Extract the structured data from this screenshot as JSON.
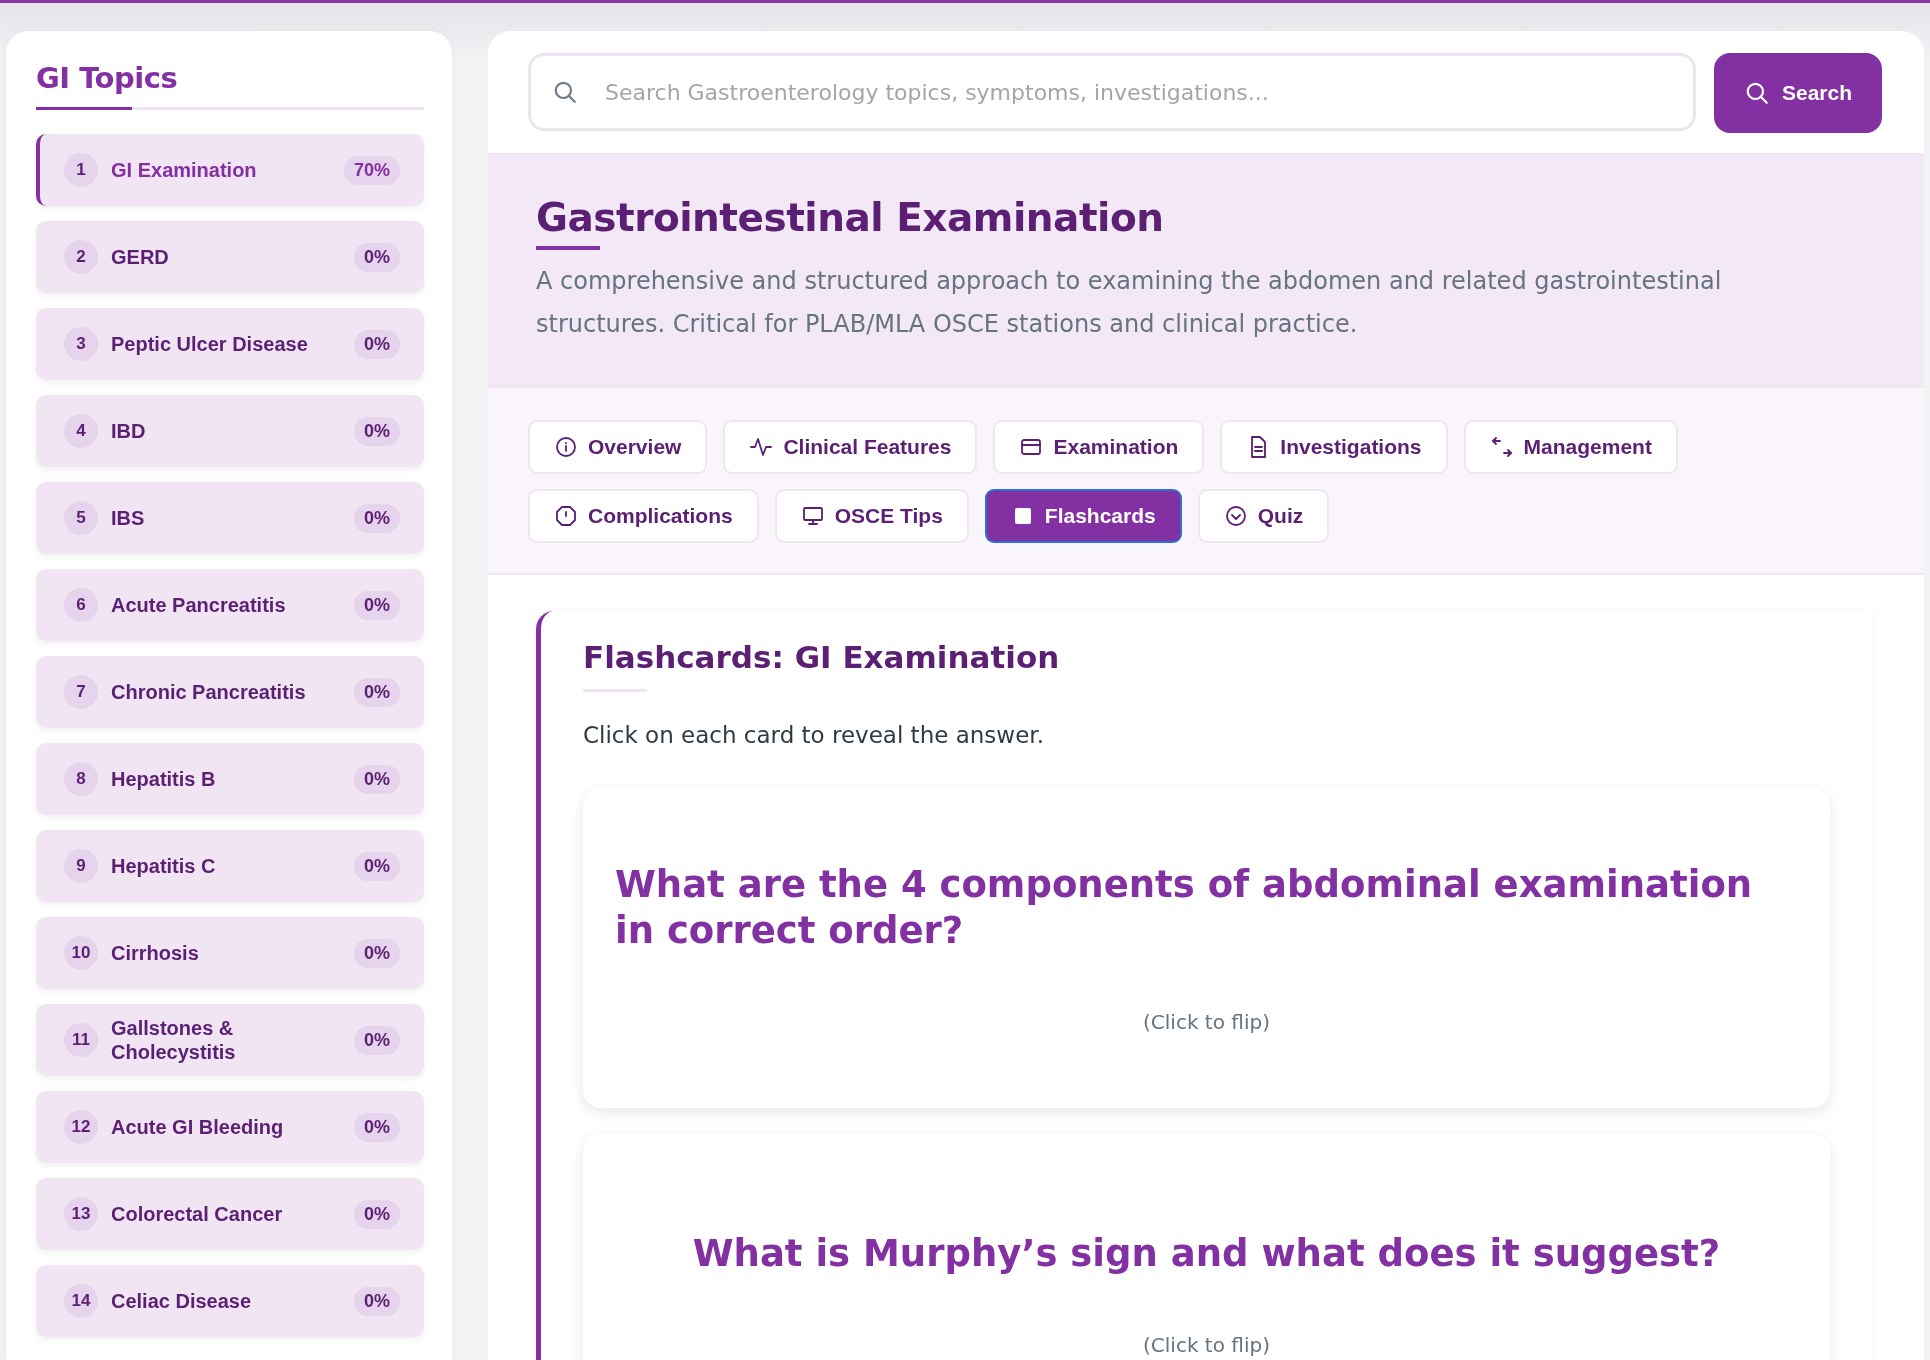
{
  "sidebar": {
    "title": "GI Topics",
    "items": [
      {
        "number": "1",
        "label": "GI Examination",
        "progress": "70%",
        "selected": true
      },
      {
        "number": "2",
        "label": "GERD",
        "progress": "0%",
        "selected": false
      },
      {
        "number": "3",
        "label": "Peptic Ulcer Disease",
        "progress": "0%",
        "selected": false
      },
      {
        "number": "4",
        "label": "IBD",
        "progress": "0%",
        "selected": false
      },
      {
        "number": "5",
        "label": "IBS",
        "progress": "0%",
        "selected": false
      },
      {
        "number": "6",
        "label": "Acute Pancreatitis",
        "progress": "0%",
        "selected": false
      },
      {
        "number": "7",
        "label": "Chronic Pancreatitis",
        "progress": "0%",
        "selected": false
      },
      {
        "number": "8",
        "label": "Hepatitis B",
        "progress": "0%",
        "selected": false
      },
      {
        "number": "9",
        "label": "Hepatitis C",
        "progress": "0%",
        "selected": false
      },
      {
        "number": "10",
        "label": "Cirrhosis",
        "progress": "0%",
        "selected": false
      },
      {
        "number": "11",
        "label": "Gallstones & Cholecystitis",
        "progress": "0%",
        "selected": false
      },
      {
        "number": "12",
        "label": "Acute GI Bleeding",
        "progress": "0%",
        "selected": false
      },
      {
        "number": "13",
        "label": "Colorectal Cancer",
        "progress": "0%",
        "selected": false
      },
      {
        "number": "14",
        "label": "Celiac Disease",
        "progress": "0%",
        "selected": false
      }
    ]
  },
  "search": {
    "placeholder": "Search Gastroenterology topics, symptoms, investigations...",
    "button": "Search"
  },
  "header": {
    "title": "Gastrointestinal Examination",
    "description": "A comprehensive and structured approach to examining the abdomen and related gastrointestinal structures. Critical for PLAB/MLA OSCE stations and clinical practice."
  },
  "tabs": [
    {
      "label": "Overview",
      "selected": false
    },
    {
      "label": "Clinical Features",
      "selected": false
    },
    {
      "label": "Examination",
      "selected": false
    },
    {
      "label": "Investigations",
      "selected": false
    },
    {
      "label": "Management",
      "selected": false
    },
    {
      "label": "Complications",
      "selected": false
    },
    {
      "label": "OSCE Tips",
      "selected": false
    },
    {
      "label": "Flashcards",
      "selected": true
    },
    {
      "label": "Quiz",
      "selected": false
    }
  ],
  "flashcards": {
    "title": "Flashcards: GI Examination",
    "instruction": "Click on each card to reveal the answer.",
    "cards": [
      {
        "question": "What are the 4 components of abdominal examination in correct order?",
        "hint": "(Click to flip)"
      },
      {
        "question": "What is Murphy’s sign and what does it suggest?",
        "hint": "(Click to flip)"
      }
    ]
  }
}
